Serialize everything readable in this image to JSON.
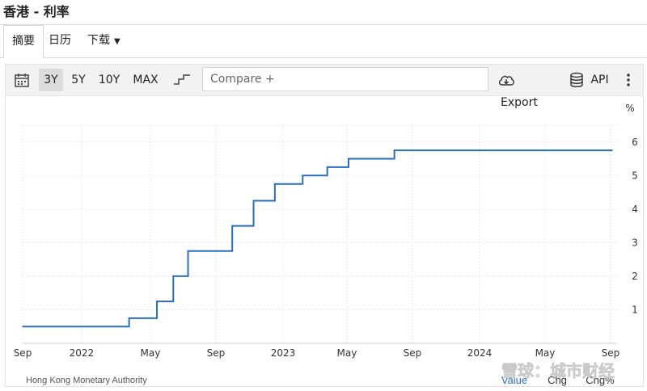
{
  "page": {
    "title": "香港 - 利率"
  },
  "tabs": [
    {
      "label": "摘要"
    },
    {
      "label": "日历"
    },
    {
      "label": "下载"
    }
  ],
  "toolbar": {
    "ranges": [
      "3Y",
      "5Y",
      "10Y",
      "MAX"
    ],
    "selected_range": "3Y",
    "compare_placeholder": "Compare +",
    "export_label": "Export",
    "api_label": "API"
  },
  "footer": {
    "source": "Hong Kong Monetary Authority",
    "tabs": [
      "Value",
      "Chg",
      "Chg%"
    ],
    "watermark": "雪球：城市财经"
  },
  "colors": {
    "line": "#2a6ebb",
    "active_footer": "#2a6ebb"
  },
  "chart_data": {
    "type": "line",
    "step": true,
    "y_unit": "%",
    "ylim": [
      0,
      6.5
    ],
    "y_ticks": [
      1,
      2,
      3,
      4,
      5,
      6
    ],
    "x_ticks": [
      {
        "label": "Sep",
        "t": 0
      },
      {
        "label": "2022",
        "t": 3.6
      },
      {
        "label": "May",
        "t": 7.8
      },
      {
        "label": "Sep",
        "t": 11.8
      },
      {
        "label": "2023",
        "t": 15.9
      },
      {
        "label": "May",
        "t": 19.8
      },
      {
        "label": "Sep",
        "t": 23.8
      },
      {
        "label": "2024",
        "t": 27.9
      },
      {
        "label": "May",
        "t": 31.9
      },
      {
        "label": "Sep",
        "t": 35.9
      }
    ],
    "grid": true,
    "series": [
      {
        "points": [
          [
            0,
            0.5
          ],
          [
            6.5,
            0.75
          ],
          [
            8.2,
            1.25
          ],
          [
            9.2,
            2.0
          ],
          [
            10.1,
            2.75
          ],
          [
            12.8,
            3.5
          ],
          [
            14.1,
            4.25
          ],
          [
            15.4,
            4.75
          ],
          [
            17.1,
            5.0
          ],
          [
            18.6,
            5.25
          ],
          [
            19.9,
            5.5
          ],
          [
            22.7,
            5.75
          ],
          [
            36.0,
            5.75
          ]
        ]
      }
    ]
  }
}
